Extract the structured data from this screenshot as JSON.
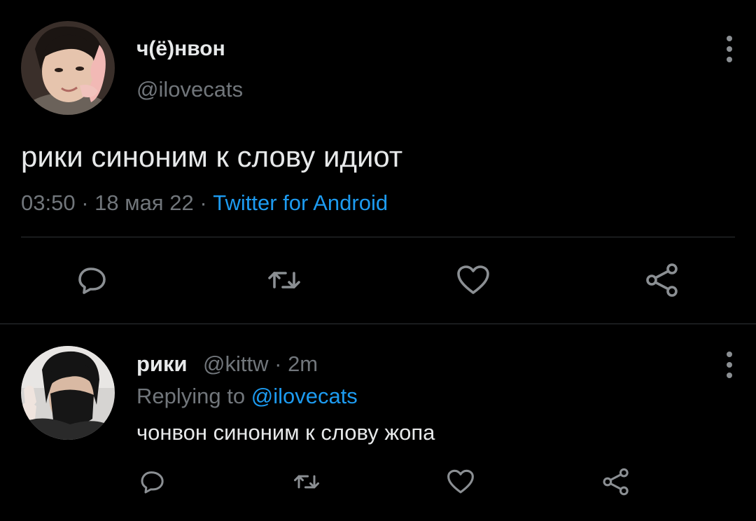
{
  "tweet": {
    "display_name": "ч(ё)нвон",
    "handle": "@ilovecats",
    "text": "рики синоним к слову идиот",
    "time": "03:50",
    "sep1": "·",
    "date": "18 мая 22",
    "sep2": "·",
    "source": "Twitter for Android",
    "avatar_icon": "user-photo-avatar",
    "actions": [
      "reply-icon",
      "retweet-icon",
      "like-icon",
      "share-icon"
    ]
  },
  "reply": {
    "display_name": "рики",
    "handle": "@kittw",
    "sep": "·",
    "time_ago": "2m",
    "replying_prefix": "Replying to",
    "replying_to": "@ilovecats",
    "text": "чонвон синоним к слову жопа",
    "avatar_icon": "user-photo-avatar",
    "actions": [
      "reply-icon",
      "retweet-icon",
      "like-icon",
      "share-icon"
    ]
  },
  "colors": {
    "background": "#000000",
    "text": "#e7e9ea",
    "secondary": "#71767b",
    "link": "#1d9bf0",
    "divider": "#2f3336",
    "icon": "#8b8f93"
  }
}
